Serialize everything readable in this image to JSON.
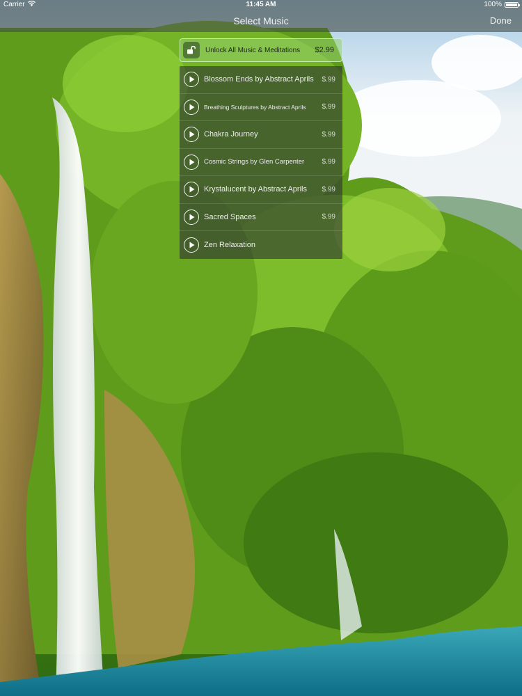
{
  "status_bar": {
    "carrier": "Carrier",
    "time": "11:45 AM",
    "battery": "100%",
    "battery_level": 1.0,
    "wifi_icon": "wifi-icon",
    "battery_icon": "battery-icon"
  },
  "nav": {
    "title": "Select Music",
    "done_label": "Done"
  },
  "unlock": {
    "label": "Unlock All Music & Meditations",
    "price": "$2.99",
    "icon": "unlock-icon"
  },
  "tracks": [
    {
      "title": "Blossom Ends by Abstract Aprils",
      "price": "$.99"
    },
    {
      "title": "Breathing Sculptures by Abstract Aprils",
      "price": "$.99"
    },
    {
      "title": "Chakra Journey",
      "price": "$.99"
    },
    {
      "title": "Cosmic Strings by Glen Carpenter",
      "price": "$.99"
    },
    {
      "title": "Krystalucent by Abstract Aprils",
      "price": "$.99"
    },
    {
      "title": "Sacred Spaces",
      "price": "$.99"
    },
    {
      "title": "Zen Relaxation",
      "price": ""
    }
  ],
  "colors": {
    "nav_bar": "#464e48",
    "unlock_highlight": "#96d26e",
    "list_background": "#2d3432"
  }
}
